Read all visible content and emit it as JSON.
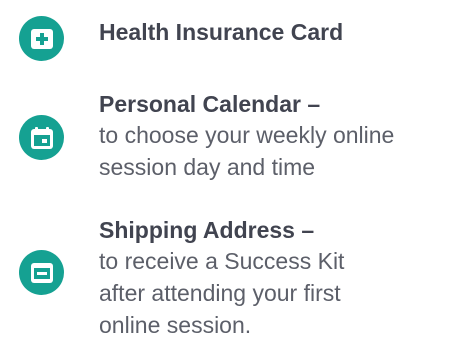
{
  "items": [
    {
      "icon": "medical-plus-icon",
      "title": "Health Insurance Card",
      "desc_lines": []
    },
    {
      "icon": "calendar-icon",
      "title": "Personal Calendar –",
      "desc_lines": [
        "to choose your weekly online",
        "session day and time"
      ]
    },
    {
      "icon": "package-box-icon",
      "title": "Shipping Address –",
      "desc_lines": [
        "to receive a Success Kit",
        "after attending your first",
        "online session."
      ]
    }
  ],
  "colors": {
    "accent": "#15a192",
    "title_text": "#414450",
    "body_text": "#5c5f69"
  }
}
